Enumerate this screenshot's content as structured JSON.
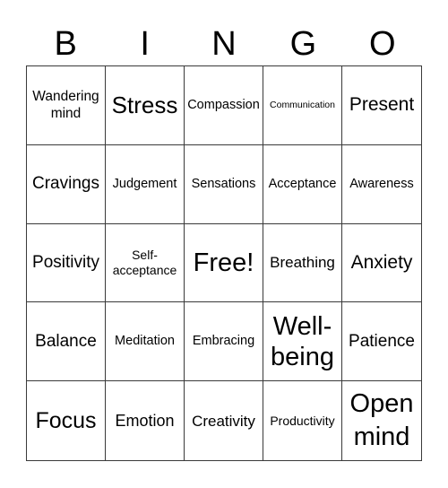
{
  "header": {
    "letters": [
      "B",
      "I",
      "N",
      "G",
      "O"
    ]
  },
  "card": {
    "rows": [
      [
        "Wandering mind",
        "Stress",
        "Compassion",
        "Communication",
        "Present"
      ],
      [
        "Cravings",
        "Judgement",
        "Sensations",
        "Acceptance",
        "Awareness"
      ],
      [
        "Positivity",
        "Self-acceptance",
        "Free!",
        "Breathing",
        "Anxiety"
      ],
      [
        "Balance",
        "Meditation",
        "Embracing",
        "Well-being",
        "Patience"
      ],
      [
        "Focus",
        "Emotion",
        "Creativity",
        "Productivity",
        "Open mind"
      ]
    ]
  },
  "colors": {
    "grid_line": "#3a3a3a",
    "text": "#000000",
    "background": "#ffffff"
  }
}
